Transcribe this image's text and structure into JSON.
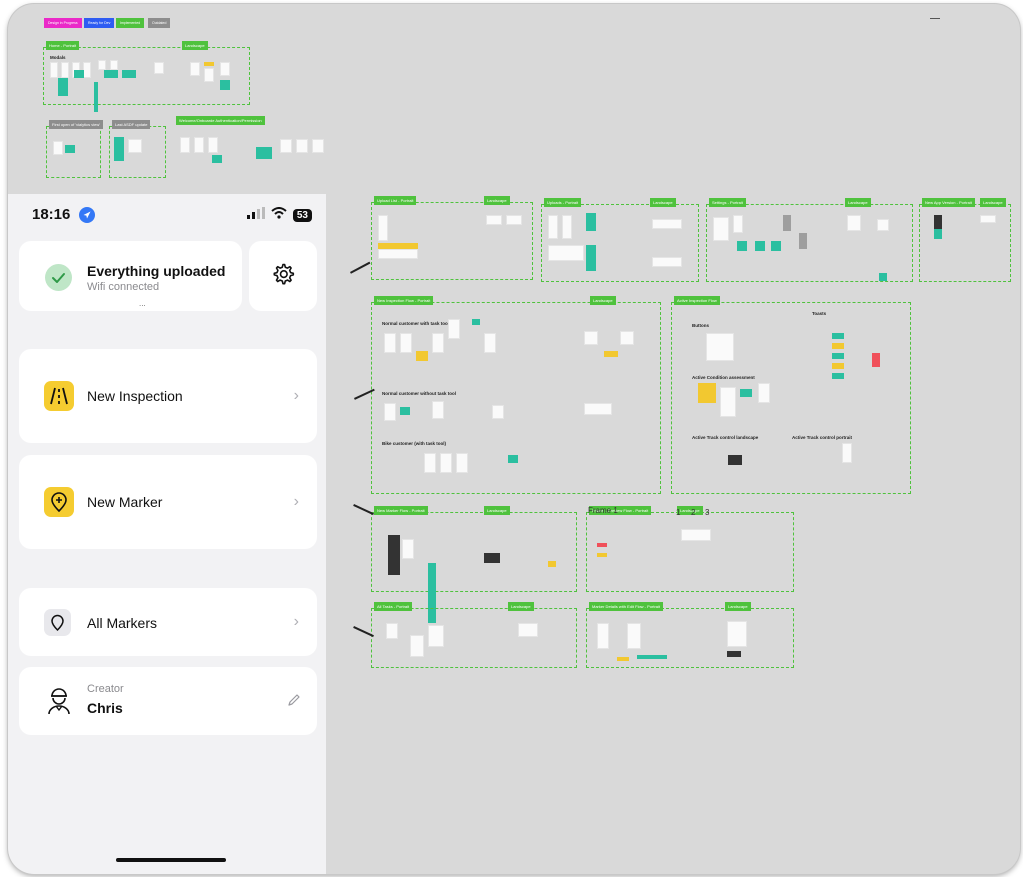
{
  "status_bar": {
    "time": "18:16",
    "battery": "53"
  },
  "upload_status": {
    "title": "Everything uploaded",
    "subtitle": "Wifi connected",
    "more": "..."
  },
  "menu": {
    "new_inspection": "New Inspection",
    "new_marker": "New Marker",
    "all_markers": "All Markers"
  },
  "creator": {
    "caption": "Creator",
    "name": "Chris"
  },
  "canvas": {
    "stray_label": "Frame 1",
    "stray_numbers": [
      "1",
      "2",
      "3"
    ],
    "legend": [
      {
        "label": "Design in Progress",
        "color": "#ea29c8"
      },
      {
        "label": "Ready for Dev",
        "color": "#2f5cf2"
      },
      {
        "label": "Implemented",
        "color": "#4fc23d"
      },
      {
        "label": "Outdated",
        "color": "#8d8d8d"
      }
    ],
    "frame_tags": {
      "home_portrait": "Home - Portrait",
      "home_landscape": "Landscape",
      "modals": "Modals",
      "first_open": "First open of 'vialytics view'",
      "last_asdf": "Last ASDF update",
      "welcome": "Welcome/Onboarde Authentication/Permission",
      "upload_portrait": "Upload List - Portrait",
      "upload_landscape": "Landscape",
      "uploads_portrait": "Uploads - Portrait",
      "uploads_landscape": "Landscape",
      "settings_portrait": "Settings - Portrait",
      "settings_landscape": "Landscape",
      "newapp_portrait": "New App Version - Portrait",
      "newapp_landscape": "Landscape",
      "newinsp_portrait": "New Inspection Flow - Portrait",
      "newinsp_landscape": "Landscape",
      "active_flow": "Active Inspection Flow",
      "newmarker_portrait": "New Marker Flow - Portrait",
      "newmarker_landscape": "Landscape",
      "frame_portrait": "Frame 1 Preview Flow - Portrait",
      "frame_landscape": "Landscape",
      "alltasks_portrait": "All Tasks - Portrait",
      "alltasks_landscape": "Landscape",
      "markerdetails_portrait": "Marker Details with Edit Flow - Portrait",
      "markerdetails_landscape": "Landscape"
    },
    "sublabels": {
      "normal_with_task": "Normal customer with task tool",
      "normal_without_task": "Normal customer without task tool",
      "bike_customer": "Bike customer (with task tool)",
      "buttons": "Buttons",
      "toasts": "Toasts",
      "active_condition": "Active Condition assessment",
      "active_track_landscape": "Active Track control landscape",
      "active_track_portrait": "Active Track control portrait"
    }
  }
}
